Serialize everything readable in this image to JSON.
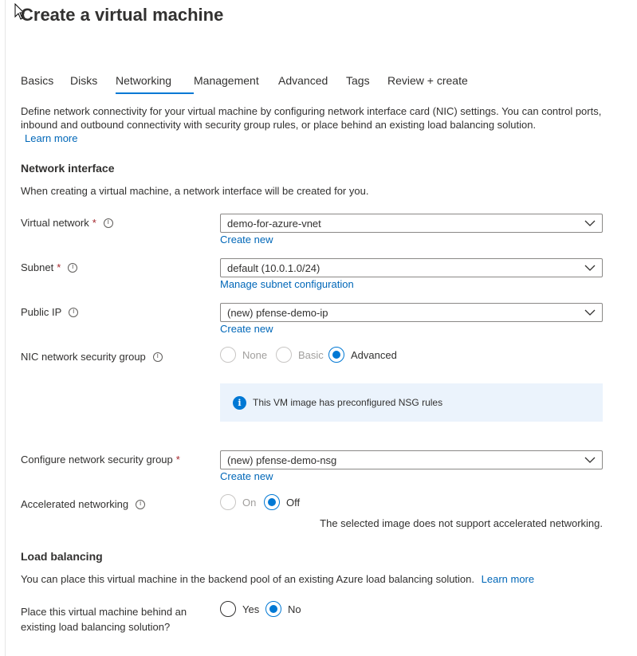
{
  "page": {
    "title": "Create a virtual machine"
  },
  "tabs": [
    {
      "label": "Basics"
    },
    {
      "label": "Disks"
    },
    {
      "label": "Networking",
      "active": true
    },
    {
      "label": "Management"
    },
    {
      "label": "Advanced"
    },
    {
      "label": "Tags"
    },
    {
      "label": "Review + create"
    }
  ],
  "intro": {
    "text": "Define network connectivity for your virtual machine by configuring network interface card (NIC) settings. You can control ports, inbound and outbound connectivity with security group rules, or place behind an existing load balancing solution.",
    "learn_more": "Learn more"
  },
  "network_interface": {
    "title": "Network interface",
    "description": "When creating a virtual machine, a network interface will be created for you.",
    "virtual_network": {
      "label": "Virtual network",
      "value": "demo-for-azure-vnet",
      "link": "Create new"
    },
    "subnet": {
      "label": "Subnet",
      "value": "default (10.0.1.0/24)",
      "link": "Manage subnet configuration"
    },
    "public_ip": {
      "label": "Public IP",
      "value": "(new) pfense-demo-ip",
      "link": "Create new"
    },
    "nic_nsg": {
      "label": "NIC network security group",
      "options": [
        "None",
        "Basic",
        "Advanced"
      ],
      "selected": "Advanced",
      "info": "This VM image has preconfigured NSG rules"
    },
    "configure_nsg": {
      "label": "Configure network security group",
      "value": "(new) pfense-demo-nsg",
      "link": "Create new"
    },
    "accelerated": {
      "label": "Accelerated networking",
      "options": [
        "On",
        "Off"
      ],
      "selected": "Off",
      "note": "The selected image does not support accelerated networking."
    }
  },
  "load_balancing": {
    "title": "Load balancing",
    "description": "You can place this virtual machine in the backend pool of an existing Azure load balancing solution.",
    "learn_more": "Learn more",
    "question_line1": "Place this virtual machine behind an",
    "question_line2": "existing load balancing solution?",
    "options": [
      "Yes",
      "No"
    ],
    "selected": "No"
  },
  "colors": {
    "accent": "#0078d4",
    "link": "#0067b8",
    "required": "#a4262c",
    "info_bg": "#ebf3fc"
  },
  "icons": {
    "info": "info-icon",
    "chevron": "chevron-down-icon",
    "cursor": "mouse-pointer-icon"
  },
  "symbols": {
    "required": "*",
    "info_glyph": "i"
  }
}
